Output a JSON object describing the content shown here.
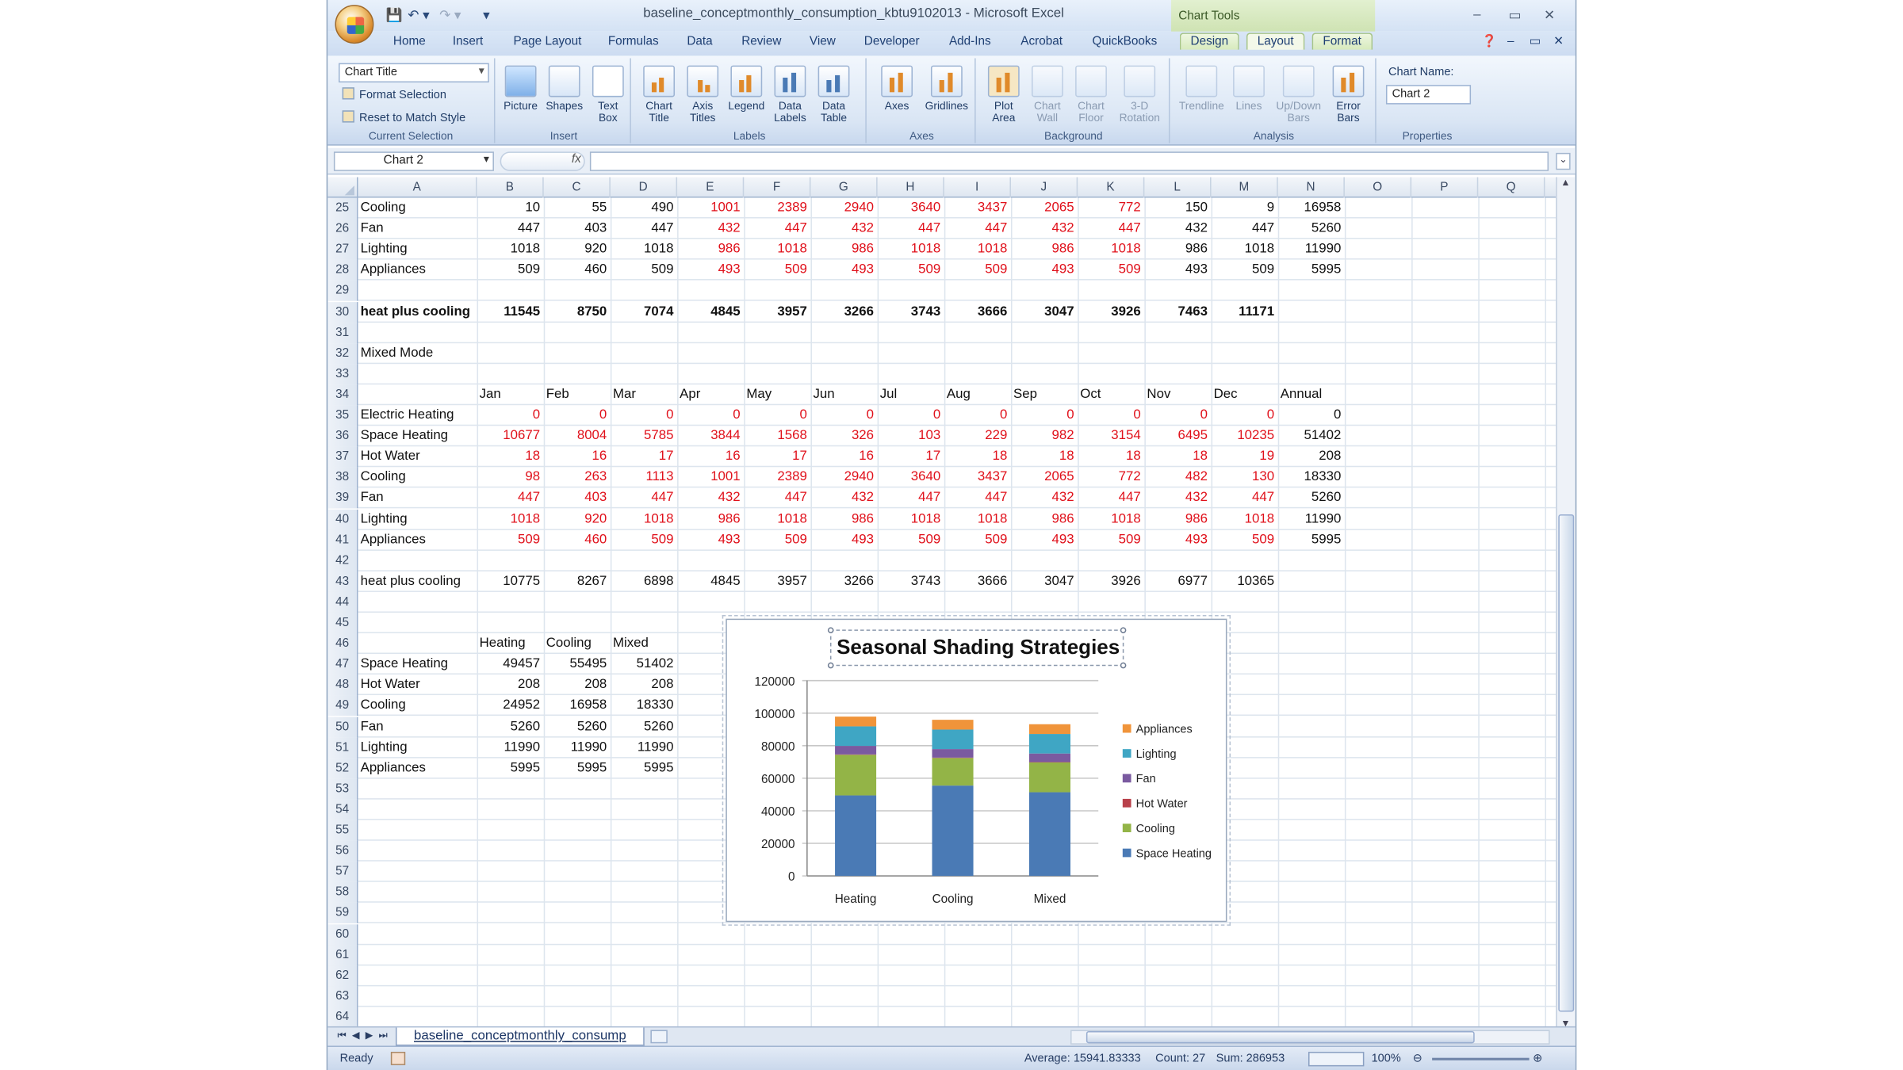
{
  "window": {
    "title": "baseline_conceptmonthly_consumption_kbtu9102013 - Microsoft Excel",
    "chart_tools_label": "Chart Tools",
    "controls": [
      "–",
      "▭",
      "✕"
    ]
  },
  "tabs": [
    "Home",
    "Insert",
    "Page Layout",
    "Formulas",
    "Data",
    "Review",
    "View",
    "Developer",
    "Add-Ins",
    "Acrobat",
    "QuickBooks"
  ],
  "context_tabs": [
    "Design",
    "Layout",
    "Format"
  ],
  "active_tab": "Layout",
  "ribbon": {
    "current_selection": {
      "dropdown": "Chart Title",
      "format_selection": "Format Selection",
      "reset_style": "Reset to Match Style",
      "label": "Current Selection"
    },
    "groups": [
      {
        "label": "Insert",
        "buttons": [
          {
            "label": "Picture",
            "icon": "picture-icon"
          },
          {
            "label": "Shapes",
            "icon": "shapes-icon"
          },
          {
            "label": "Text Box",
            "icon": "text-box-icon"
          }
        ]
      },
      {
        "label": "Labels",
        "buttons": [
          {
            "label": "Chart Title",
            "icon": "chart-title-icon"
          },
          {
            "label": "Axis Titles",
            "icon": "axis-titles-icon"
          },
          {
            "label": "Legend",
            "icon": "legend-icon"
          },
          {
            "label": "Data Labels",
            "icon": "data-labels-icon"
          },
          {
            "label": "Data Table",
            "icon": "data-table-icon"
          }
        ]
      },
      {
        "label": "Axes",
        "buttons": [
          {
            "label": "Axes",
            "icon": "axes-icon"
          },
          {
            "label": "Gridlines",
            "icon": "gridlines-icon"
          }
        ]
      },
      {
        "label": "Background",
        "buttons": [
          {
            "label": "Plot Area",
            "icon": "plot-area-icon"
          },
          {
            "label": "Chart Wall",
            "icon": "chart-wall-icon"
          },
          {
            "label": "Chart Floor",
            "icon": "chart-floor-icon"
          },
          {
            "label": "3-D Rotation",
            "icon": "3d-rotation-icon"
          }
        ]
      },
      {
        "label": "Analysis",
        "buttons": [
          {
            "label": "Trendline",
            "icon": "trendline-icon"
          },
          {
            "label": "Lines",
            "icon": "lines-icon"
          },
          {
            "label": "Up/Down Bars",
            "icon": "updown-bars-icon"
          },
          {
            "label": "Error Bars",
            "icon": "error-bars-icon"
          }
        ]
      }
    ],
    "properties": {
      "label": "Properties",
      "chart_name_label": "Chart Name:",
      "chart_name": "Chart 2"
    }
  },
  "formula_bar": {
    "name_box": "Chart 2",
    "fx": "fx",
    "formula": ""
  },
  "columns": [
    "A",
    "B",
    "C",
    "D",
    "E",
    "F",
    "G",
    "H",
    "I",
    "J",
    "K",
    "L",
    "M",
    "N",
    "O",
    "P",
    "Q"
  ],
  "rows": [
    {
      "n": "25",
      "cells": {
        "A": "Cooling",
        "B": "10",
        "C": "55",
        "D": "490",
        "E": "1001",
        "F": "2389",
        "G": "2940",
        "H": "3640",
        "I": "3437",
        "J": "2065",
        "K": "772",
        "L": "150",
        "M": "9",
        "N": "16958"
      },
      "red": [
        "E",
        "F",
        "G",
        "H",
        "I",
        "J",
        "K"
      ]
    },
    {
      "n": "26",
      "cells": {
        "A": "Fan",
        "B": "447",
        "C": "403",
        "D": "447",
        "E": "432",
        "F": "447",
        "G": "432",
        "H": "447",
        "I": "447",
        "J": "432",
        "K": "447",
        "L": "432",
        "M": "447",
        "N": "5260"
      },
      "red": [
        "E",
        "F",
        "G",
        "H",
        "I",
        "J",
        "K"
      ]
    },
    {
      "n": "27",
      "cells": {
        "A": "Lighting",
        "B": "1018",
        "C": "920",
        "D": "1018",
        "E": "986",
        "F": "1018",
        "G": "986",
        "H": "1018",
        "I": "1018",
        "J": "986",
        "K": "1018",
        "L": "986",
        "M": "1018",
        "N": "11990"
      },
      "red": [
        "E",
        "F",
        "G",
        "H",
        "I",
        "J",
        "K"
      ]
    },
    {
      "n": "28",
      "cells": {
        "A": "Appliances",
        "B": "509",
        "C": "460",
        "D": "509",
        "E": "493",
        "F": "509",
        "G": "493",
        "H": "509",
        "I": "509",
        "J": "493",
        "K": "509",
        "L": "493",
        "M": "509",
        "N": "5995"
      },
      "red": [
        "E",
        "F",
        "G",
        "H",
        "I",
        "J",
        "K"
      ]
    },
    {
      "n": "29",
      "cells": {}
    },
    {
      "n": "30",
      "cells": {
        "A": "heat plus cooling",
        "B": "11545",
        "C": "8750",
        "D": "7074",
        "E": "4845",
        "F": "3957",
        "G": "3266",
        "H": "3743",
        "I": "3666",
        "J": "3047",
        "K": "3926",
        "L": "7463",
        "M": "11171"
      },
      "bold": true
    },
    {
      "n": "31",
      "cells": {}
    },
    {
      "n": "32",
      "cells": {
        "A": "Mixed Mode"
      }
    },
    {
      "n": "33",
      "cells": {}
    },
    {
      "n": "34",
      "cells": {
        "B": "Jan",
        "C": "Feb",
        "D": "Mar",
        "E": "Apr",
        "F": "May",
        "G": "Jun",
        "H": "Jul",
        "I": "Aug",
        "J": "Sep",
        "K": "Oct",
        "L": "Nov",
        "M": "Dec",
        "N": "Annual"
      },
      "textcols": true
    },
    {
      "n": "35",
      "cells": {
        "A": "Electric Heating",
        "B": "0",
        "C": "0",
        "D": "0",
        "E": "0",
        "F": "0",
        "G": "0",
        "H": "0",
        "I": "0",
        "J": "0",
        "K": "0",
        "L": "0",
        "M": "0",
        "N": "0"
      },
      "red": [
        "B",
        "C",
        "D",
        "E",
        "F",
        "G",
        "H",
        "I",
        "J",
        "K",
        "L",
        "M"
      ]
    },
    {
      "n": "36",
      "cells": {
        "A": "Space Heating",
        "B": "10677",
        "C": "8004",
        "D": "5785",
        "E": "3844",
        "F": "1568",
        "G": "326",
        "H": "103",
        "I": "229",
        "J": "982",
        "K": "3154",
        "L": "6495",
        "M": "10235",
        "N": "51402"
      },
      "red": [
        "B",
        "C",
        "D",
        "E",
        "F",
        "G",
        "H",
        "I",
        "J",
        "K",
        "L",
        "M"
      ]
    },
    {
      "n": "37",
      "cells": {
        "A": "Hot Water",
        "B": "18",
        "C": "16",
        "D": "17",
        "E": "16",
        "F": "17",
        "G": "16",
        "H": "17",
        "I": "18",
        "J": "18",
        "K": "18",
        "L": "18",
        "M": "19",
        "N": "208"
      },
      "red": [
        "B",
        "C",
        "D",
        "E",
        "F",
        "G",
        "H",
        "I",
        "J",
        "K",
        "L",
        "M"
      ]
    },
    {
      "n": "38",
      "cells": {
        "A": "Cooling",
        "B": "98",
        "C": "263",
        "D": "1113",
        "E": "1001",
        "F": "2389",
        "G": "2940",
        "H": "3640",
        "I": "3437",
        "J": "2065",
        "K": "772",
        "L": "482",
        "M": "130",
        "N": "18330"
      },
      "red": [
        "B",
        "C",
        "D",
        "E",
        "F",
        "G",
        "H",
        "I",
        "J",
        "K",
        "L",
        "M"
      ]
    },
    {
      "n": "39",
      "cells": {
        "A": "Fan",
        "B": "447",
        "C": "403",
        "D": "447",
        "E": "432",
        "F": "447",
        "G": "432",
        "H": "447",
        "I": "447",
        "J": "432",
        "K": "447",
        "L": "432",
        "M": "447",
        "N": "5260"
      },
      "red": [
        "B",
        "C",
        "D",
        "E",
        "F",
        "G",
        "H",
        "I",
        "J",
        "K",
        "L",
        "M"
      ]
    },
    {
      "n": "40",
      "cells": {
        "A": "Lighting",
        "B": "1018",
        "C": "920",
        "D": "1018",
        "E": "986",
        "F": "1018",
        "G": "986",
        "H": "1018",
        "I": "1018",
        "J": "986",
        "K": "1018",
        "L": "986",
        "M": "1018",
        "N": "11990"
      },
      "red": [
        "B",
        "C",
        "D",
        "E",
        "F",
        "G",
        "H",
        "I",
        "J",
        "K",
        "L",
        "M"
      ]
    },
    {
      "n": "41",
      "cells": {
        "A": "Appliances",
        "B": "509",
        "C": "460",
        "D": "509",
        "E": "493",
        "F": "509",
        "G": "493",
        "H": "509",
        "I": "509",
        "J": "493",
        "K": "509",
        "L": "493",
        "M": "509",
        "N": "5995"
      },
      "red": [
        "B",
        "C",
        "D",
        "E",
        "F",
        "G",
        "H",
        "I",
        "J",
        "K",
        "L",
        "M"
      ]
    },
    {
      "n": "42",
      "cells": {}
    },
    {
      "n": "43",
      "cells": {
        "A": "heat plus cooling",
        "B": "10775",
        "C": "8267",
        "D": "6898",
        "E": "4845",
        "F": "3957",
        "G": "3266",
        "H": "3743",
        "I": "3666",
        "J": "3047",
        "K": "3926",
        "L": "6977",
        "M": "10365"
      }
    },
    {
      "n": "44",
      "cells": {}
    },
    {
      "n": "45",
      "cells": {}
    },
    {
      "n": "46",
      "cells": {
        "B": "Heating",
        "C": "Cooling",
        "D": "Mixed"
      },
      "textcols": true
    },
    {
      "n": "47",
      "cells": {
        "A": "Space Heating",
        "B": "49457",
        "C": "55495",
        "D": "51402"
      }
    },
    {
      "n": "48",
      "cells": {
        "A": "Hot Water",
        "B": "208",
        "C": "208",
        "D": "208"
      }
    },
    {
      "n": "49",
      "cells": {
        "A": "Cooling",
        "B": "24952",
        "C": "16958",
        "D": "18330"
      }
    },
    {
      "n": "50",
      "cells": {
        "A": "Fan",
        "B": "5260",
        "C": "5260",
        "D": "5260"
      }
    },
    {
      "n": "51",
      "cells": {
        "A": "Lighting",
        "B": "11990",
        "C": "11990",
        "D": "11990"
      }
    },
    {
      "n": "52",
      "cells": {
        "A": "Appliances",
        "B": "5995",
        "C": "5995",
        "D": "5995"
      }
    },
    {
      "n": "53",
      "cells": {}
    },
    {
      "n": "54",
      "cells": {}
    },
    {
      "n": "55",
      "cells": {}
    },
    {
      "n": "56",
      "cells": {}
    },
    {
      "n": "57",
      "cells": {}
    },
    {
      "n": "58",
      "cells": {}
    },
    {
      "n": "59",
      "cells": {}
    },
    {
      "n": "60",
      "cells": {}
    },
    {
      "n": "61",
      "cells": {}
    },
    {
      "n": "62",
      "cells": {}
    },
    {
      "n": "63",
      "cells": {}
    },
    {
      "n": "64",
      "cells": {}
    }
  ],
  "sheet_tab": "baseline_conceptmonthly_consump",
  "status": {
    "ready": "Ready",
    "average": "Average: 15941.83333",
    "count": "Count: 27",
    "sum": "Sum: 286953",
    "zoom": "100%"
  },
  "colors": {
    "red_text": "#e0101a",
    "space_heating": "#4a7ab5",
    "cooling": "#93b447",
    "hot_water": "#b8404a",
    "fan": "#7a5aa0",
    "lighting": "#3fa6c4",
    "appliances": "#f0943a"
  },
  "chart_data": {
    "type": "bar",
    "stacked": true,
    "title": "Seasonal Shading Strategies",
    "categories": [
      "Heating",
      "Cooling",
      "Mixed"
    ],
    "ylim": [
      0,
      120000
    ],
    "yticks": [
      "0",
      "20000",
      "40000",
      "60000",
      "80000",
      "100000",
      "120000"
    ],
    "legend_position": "right",
    "series": [
      {
        "name": "Space Heating",
        "values": [
          49457,
          55495,
          51402
        ],
        "color": "#4a7ab5"
      },
      {
        "name": "Cooling",
        "values": [
          24952,
          16958,
          18330
        ],
        "color": "#93b447"
      },
      {
        "name": "Hot Water",
        "values": [
          208,
          208,
          208
        ],
        "color": "#b8404a"
      },
      {
        "name": "Fan",
        "values": [
          5260,
          5260,
          5260
        ],
        "color": "#7a5aa0"
      },
      {
        "name": "Lighting",
        "values": [
          11990,
          11990,
          11990
        ],
        "color": "#3fa6c4"
      },
      {
        "name": "Appliances",
        "values": [
          5995,
          5995,
          5995
        ],
        "color": "#f0943a"
      }
    ]
  }
}
